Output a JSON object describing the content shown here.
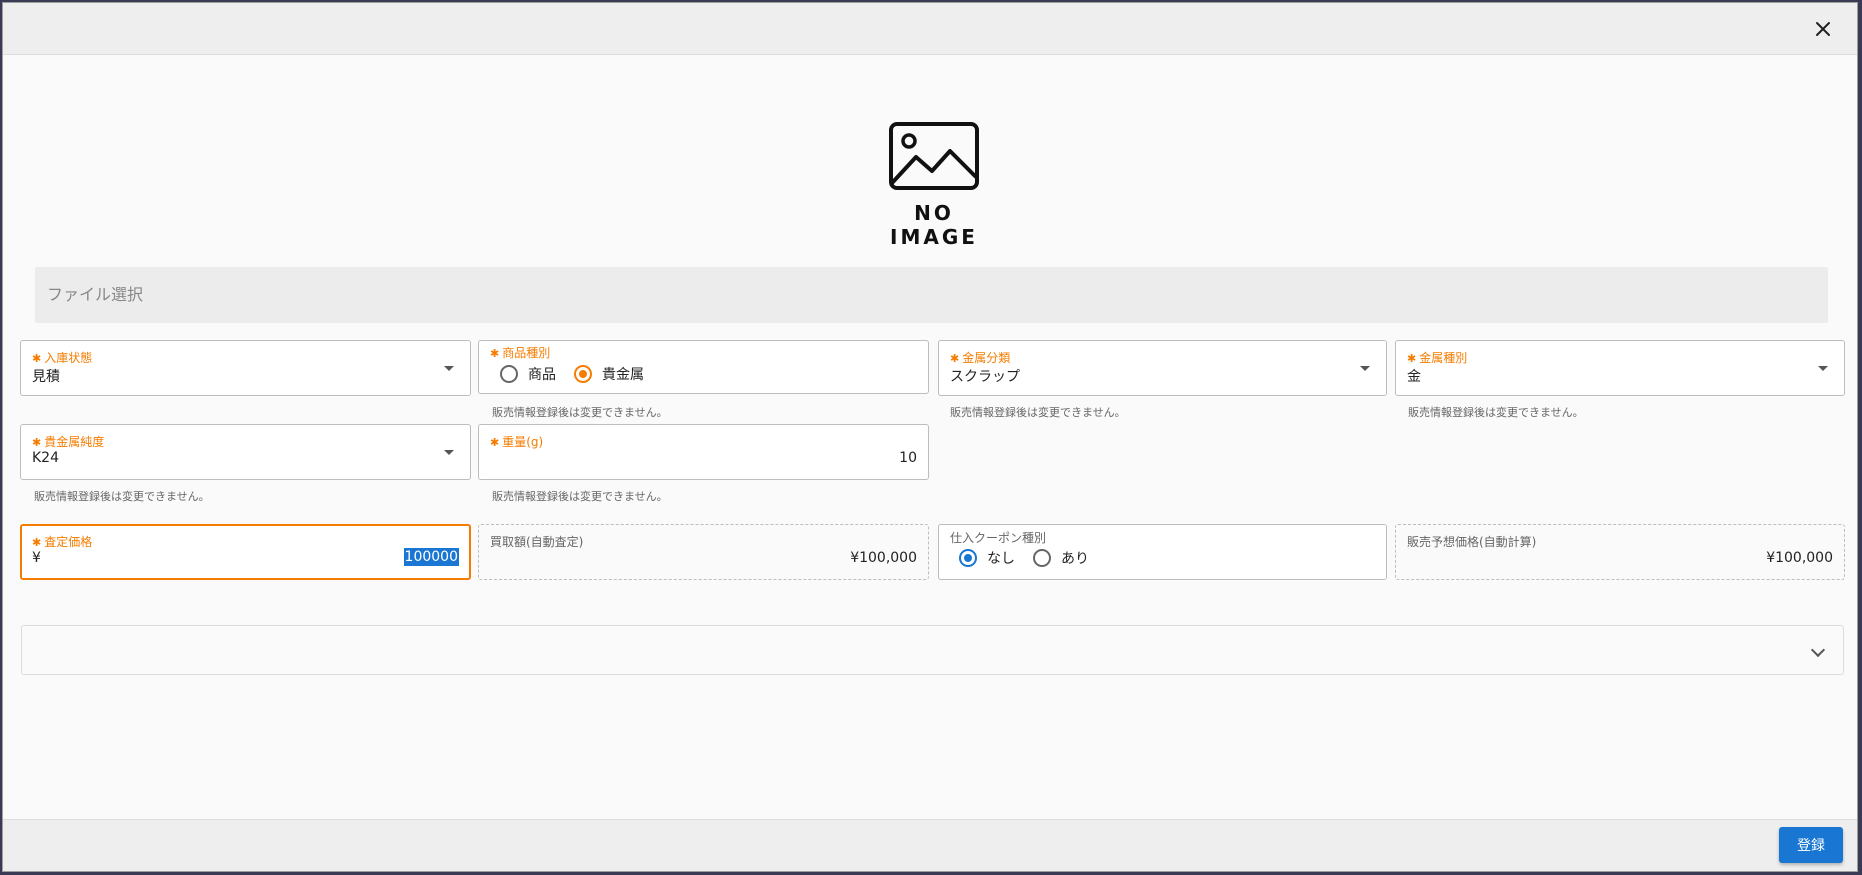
{
  "image": {
    "placeholder_text": "NO IMAGE"
  },
  "file_select": {
    "label": "ファイル選択"
  },
  "fields": {
    "stock_status": {
      "label": "入庫状態",
      "value": "見積"
    },
    "product_type": {
      "label": "商品種別",
      "options": [
        "商品",
        "貴金属"
      ],
      "selected": "貴金属",
      "hint": "販売情報登録後は変更できません。"
    },
    "metal_category": {
      "label": "金属分類",
      "value": "スクラップ",
      "hint": "販売情報登録後は変更できません。"
    },
    "metal_type": {
      "label": "金属種別",
      "value": "金",
      "hint": "販売情報登録後は変更できません。"
    },
    "purity": {
      "label": "貴金属純度",
      "value": "K24",
      "hint": "販売情報登録後は変更できません。"
    },
    "weight": {
      "label": "重量(g)",
      "value": "10",
      "hint": "販売情報登録後は変更できません。"
    },
    "appraisal_price": {
      "label": "査定価格",
      "currency": "¥",
      "value": "100000"
    },
    "purchase_amount": {
      "label": "買取額(自動査定)",
      "value": "¥100,000"
    },
    "coupon_type": {
      "label": "仕入クーポン種別",
      "options": [
        "なし",
        "あり"
      ],
      "selected": "なし"
    },
    "expected_price": {
      "label": "販売予想価格(自動計算)",
      "value": "¥100,000"
    }
  },
  "footer": {
    "submit_label": "登録"
  },
  "colors": {
    "required_accent": "#f57c00",
    "primary": "#1976d2"
  }
}
